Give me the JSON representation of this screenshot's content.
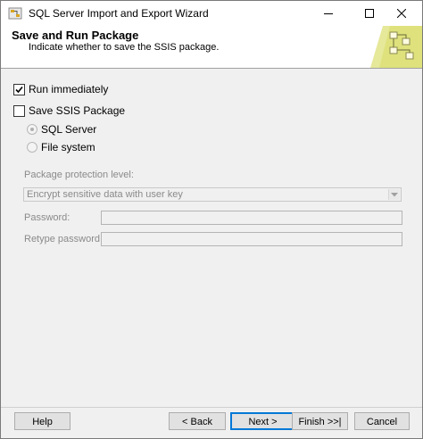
{
  "window": {
    "title": "SQL Server Import and Export Wizard"
  },
  "header": {
    "title": "Save and Run Package",
    "subtitle": "Indicate whether to save the SSIS package."
  },
  "options": {
    "run_immediately": {
      "label": "Run immediately",
      "checked": true
    },
    "save_ssis_package": {
      "label": "Save SSIS Package",
      "checked": false
    },
    "sql_server": {
      "label": "SQL Server",
      "selected": true,
      "enabled": false
    },
    "file_system": {
      "label": "File system",
      "selected": false,
      "enabled": false
    }
  },
  "protection": {
    "label": "Package protection level:",
    "value": "Encrypt sensitive data with user key"
  },
  "password": {
    "label": "Password:",
    "value": ""
  },
  "retype_password": {
    "label": "Retype password:",
    "value": ""
  },
  "buttons": {
    "help": "Help",
    "back": "< Back",
    "next": "Next >",
    "finish": "Finish >>|",
    "cancel": "Cancel"
  },
  "icons": {
    "app": "wizard-app-icon",
    "banner": "package-flow-icon",
    "minimize": "minimize-icon",
    "maximize": "maximize-icon",
    "close": "close-icon"
  }
}
